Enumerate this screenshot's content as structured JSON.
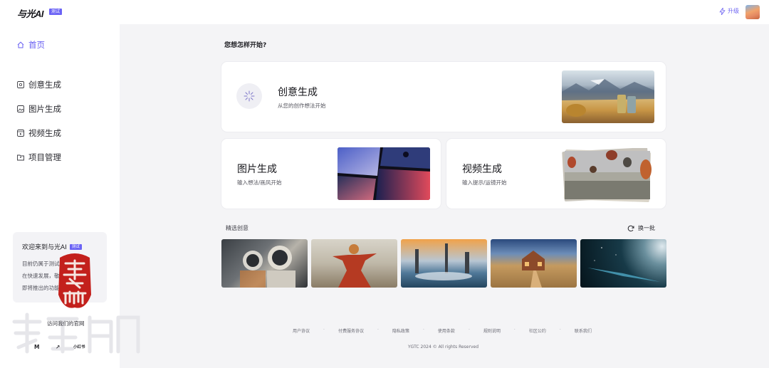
{
  "header": {
    "logo": "与光AI",
    "badge": "测试",
    "upgrade_label": "升级"
  },
  "sidebar": {
    "items": [
      {
        "label": "首页",
        "icon": "home-icon"
      },
      {
        "label": "创意生成",
        "icon": "sparkle-icon"
      },
      {
        "label": "图片生成",
        "icon": "image-icon"
      },
      {
        "label": "视频生成",
        "icon": "video-icon"
      },
      {
        "label": "项目管理",
        "icon": "folder-icon"
      }
    ],
    "welcome": {
      "title": "欢迎来到与光AI",
      "badge": "测试",
      "body_lines": [
        "目前仍属于测试阶段，正",
        "在快速发展，敬请期待和",
        "即将推出的功能"
      ]
    },
    "official_site": "访问我们的官网",
    "social": [
      "M",
      "↗",
      "小红书"
    ]
  },
  "main": {
    "question": "您想怎样开始?",
    "creative": {
      "title": "创意生成",
      "subtitle": "从您的创作想法开始"
    },
    "image": {
      "title": "图片生成",
      "subtitle": "输入想法/画风开始"
    },
    "video": {
      "title": "视频生成",
      "subtitle": "输入提示/运镜开始"
    },
    "featured_label": "精选创意",
    "refresh_label": "换一批"
  },
  "footer": {
    "links": [
      "用户协议",
      "付费服务协议",
      "隐私政策",
      "使用条款",
      "规则说明",
      "社区公约",
      "联系我们"
    ],
    "copyright": "YGTC 2024 © All rights Reserved"
  },
  "colors": {
    "accent": "#6b63f5",
    "background": "#f4f4f6",
    "card": "#ffffff"
  }
}
